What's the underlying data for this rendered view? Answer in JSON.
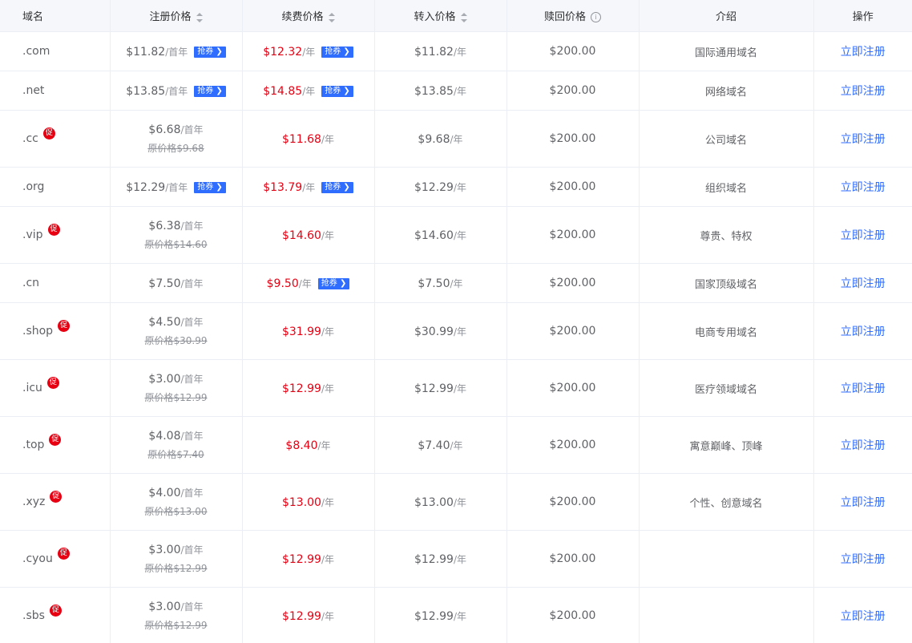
{
  "header": {
    "domain": "域名",
    "register": "注册价格",
    "renew": "续费价格",
    "transfer": "转入价格",
    "redeem": "赎回价格",
    "redeem_info_icon": "i",
    "intro": "介绍",
    "action": "操作"
  },
  "labels": {
    "coupon": "抢券",
    "promo": "促"
  },
  "rows": [
    {
      "domain": ".com",
      "promo": false,
      "reg_price": "$11.82",
      "reg_unit": "/首年",
      "reg_coupon": true,
      "orig": "",
      "renew_price": "$12.32",
      "renew_unit": "/年",
      "renew_coupon": true,
      "transfer_price": "$11.82",
      "transfer_unit": "/年",
      "redeem": "$200.00",
      "intro": "国际通用域名",
      "action": "立即注册"
    },
    {
      "domain": ".net",
      "promo": false,
      "reg_price": "$13.85",
      "reg_unit": "/首年",
      "reg_coupon": true,
      "orig": "",
      "renew_price": "$14.85",
      "renew_unit": "/年",
      "renew_coupon": true,
      "transfer_price": "$13.85",
      "transfer_unit": "/年",
      "redeem": "$200.00",
      "intro": "网络域名",
      "action": "立即注册"
    },
    {
      "domain": ".cc",
      "promo": true,
      "reg_price": "$6.68",
      "reg_unit": "/首年",
      "reg_coupon": false,
      "orig": "原价格$9.68",
      "renew_price": "$11.68",
      "renew_unit": "/年",
      "renew_coupon": false,
      "transfer_price": "$9.68",
      "transfer_unit": "/年",
      "redeem": "$200.00",
      "intro": "公司域名",
      "action": "立即注册"
    },
    {
      "domain": ".org",
      "promo": false,
      "reg_price": "$12.29",
      "reg_unit": "/首年",
      "reg_coupon": true,
      "orig": "",
      "renew_price": "$13.79",
      "renew_unit": "/年",
      "renew_coupon": true,
      "transfer_price": "$12.29",
      "transfer_unit": "/年",
      "redeem": "$200.00",
      "intro": "组织域名",
      "action": "立即注册"
    },
    {
      "domain": ".vip",
      "promo": true,
      "reg_price": "$6.38",
      "reg_unit": "/首年",
      "reg_coupon": false,
      "orig": "原价格$14.60",
      "renew_price": "$14.60",
      "renew_unit": "/年",
      "renew_coupon": false,
      "transfer_price": "$14.60",
      "transfer_unit": "/年",
      "redeem": "$200.00",
      "intro": "尊贵、特权",
      "action": "立即注册"
    },
    {
      "domain": ".cn",
      "promo": false,
      "reg_price": "$7.50",
      "reg_unit": "/首年",
      "reg_coupon": false,
      "orig": "",
      "renew_price": "$9.50",
      "renew_unit": "/年",
      "renew_coupon": true,
      "transfer_price": "$7.50",
      "transfer_unit": "/年",
      "redeem": "$200.00",
      "intro": "国家顶级域名",
      "action": "立即注册"
    },
    {
      "domain": ".shop",
      "promo": true,
      "reg_price": "$4.50",
      "reg_unit": "/首年",
      "reg_coupon": false,
      "orig": "原价格$30.99",
      "renew_price": "$31.99",
      "renew_unit": "/年",
      "renew_coupon": false,
      "transfer_price": "$30.99",
      "transfer_unit": "/年",
      "redeem": "$200.00",
      "intro": "电商专用域名",
      "action": "立即注册"
    },
    {
      "domain": ".icu",
      "promo": true,
      "reg_price": "$3.00",
      "reg_unit": "/首年",
      "reg_coupon": false,
      "orig": "原价格$12.99",
      "renew_price": "$12.99",
      "renew_unit": "/年",
      "renew_coupon": false,
      "transfer_price": "$12.99",
      "transfer_unit": "/年",
      "redeem": "$200.00",
      "intro": "医疗领域域名",
      "action": "立即注册"
    },
    {
      "domain": ".top",
      "promo": true,
      "reg_price": "$4.08",
      "reg_unit": "/首年",
      "reg_coupon": false,
      "orig": "原价格$7.40",
      "renew_price": "$8.40",
      "renew_unit": "/年",
      "renew_coupon": false,
      "transfer_price": "$7.40",
      "transfer_unit": "/年",
      "redeem": "$200.00",
      "intro": "寓意巅峰、顶峰",
      "action": "立即注册"
    },
    {
      "domain": ".xyz",
      "promo": true,
      "reg_price": "$4.00",
      "reg_unit": "/首年",
      "reg_coupon": false,
      "orig": "原价格$13.00",
      "renew_price": "$13.00",
      "renew_unit": "/年",
      "renew_coupon": false,
      "transfer_price": "$13.00",
      "transfer_unit": "/年",
      "redeem": "$200.00",
      "intro": "个性、创意域名",
      "action": "立即注册"
    },
    {
      "domain": ".cyou",
      "promo": true,
      "reg_price": "$3.00",
      "reg_unit": "/首年",
      "reg_coupon": false,
      "orig": "原价格$12.99",
      "renew_price": "$12.99",
      "renew_unit": "/年",
      "renew_coupon": false,
      "transfer_price": "$12.99",
      "transfer_unit": "/年",
      "redeem": "$200.00",
      "intro": "",
      "action": "立即注册"
    },
    {
      "domain": ".sbs",
      "promo": true,
      "reg_price": "$3.00",
      "reg_unit": "/首年",
      "reg_coupon": false,
      "orig": "原价格$12.99",
      "renew_price": "$12.99",
      "renew_unit": "/年",
      "renew_coupon": false,
      "transfer_price": "$12.99",
      "transfer_unit": "/年",
      "redeem": "$200.00",
      "intro": "",
      "action": "立即注册"
    }
  ]
}
